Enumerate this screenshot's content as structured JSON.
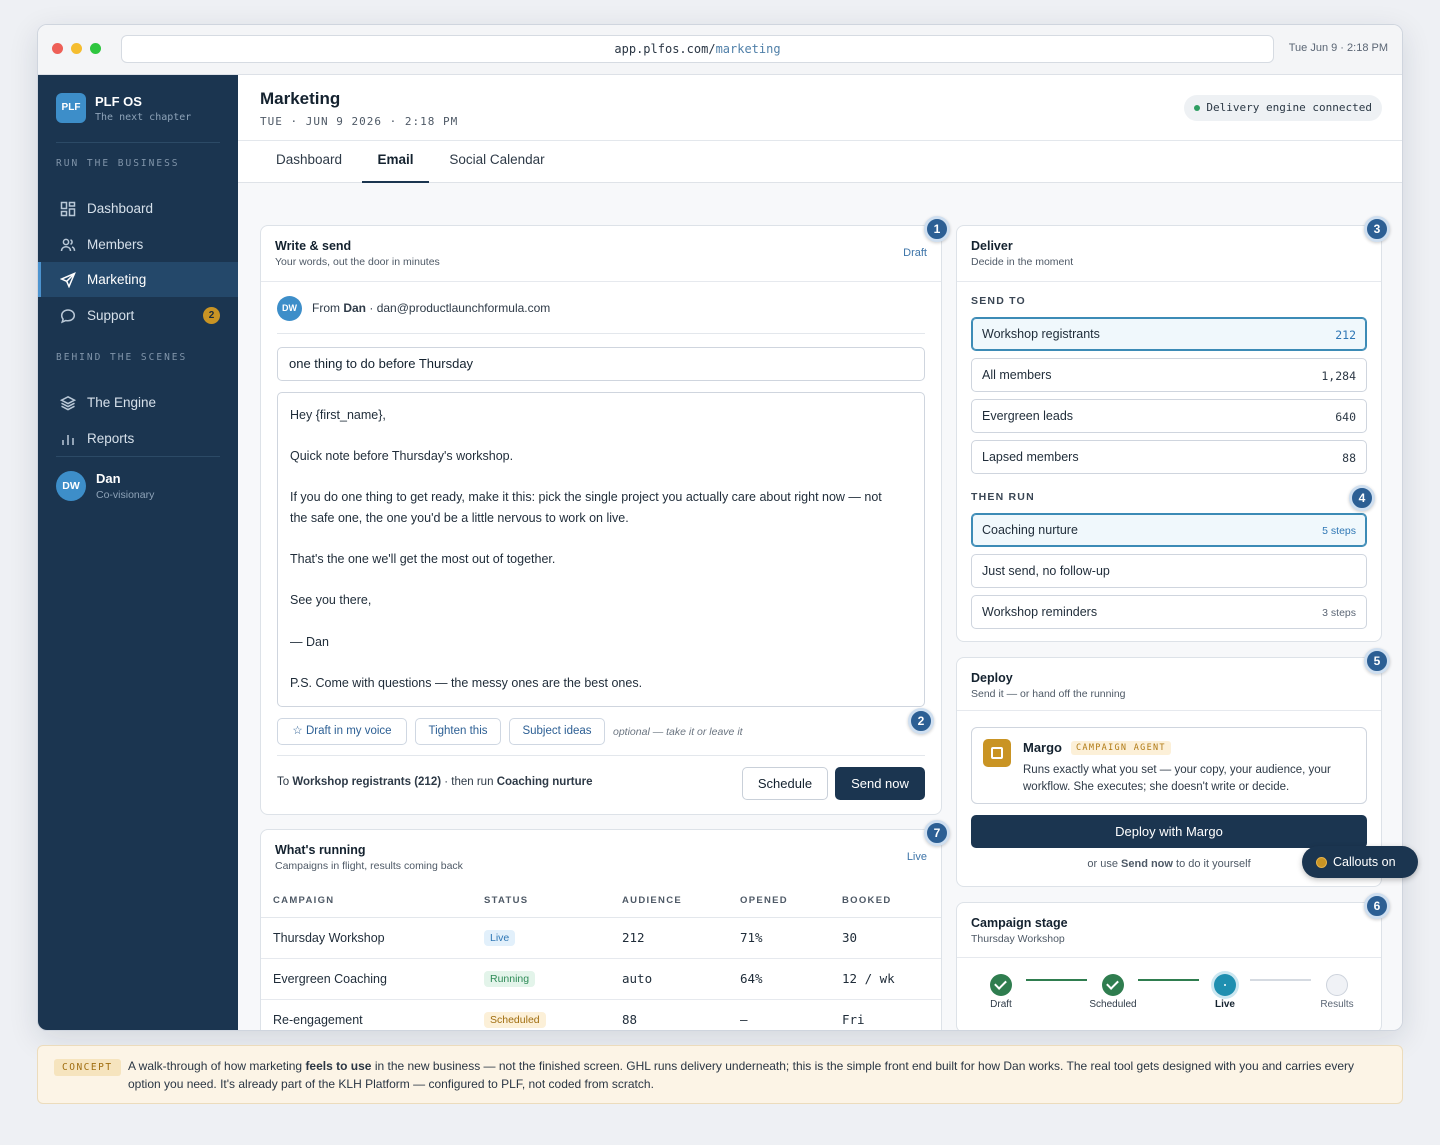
{
  "window": {
    "url_host": "app.plfos.com/",
    "url_path": "marketing",
    "clock": "Tue Jun 9 · 2:18 PM"
  },
  "sidebar": {
    "brand_badge": "PLF",
    "brand_name": "PLF OS",
    "brand_tagline": "The next chapter",
    "section_run": "RUN THE BUSINESS",
    "section_behind": "BEHIND THE SCENES",
    "items": [
      {
        "label": "Dashboard",
        "icon": "grid-icon"
      },
      {
        "label": "Members",
        "icon": "users-icon"
      },
      {
        "label": "Marketing",
        "icon": "send-icon",
        "active": true
      },
      {
        "label": "Support",
        "icon": "chat-icon",
        "badge": "2"
      },
      {
        "label": "The Engine",
        "icon": "layers-icon"
      },
      {
        "label": "Reports",
        "icon": "bar-chart-icon"
      }
    ],
    "user": {
      "initials": "DW",
      "name": "Dan",
      "role": "Co-visionary"
    }
  },
  "header": {
    "title": "Marketing",
    "date": "TUE · JUN 9 2026 · 2:18 PM",
    "status": "Delivery engine connected"
  },
  "tabs": [
    {
      "label": "Dashboard"
    },
    {
      "label": "Email",
      "active": true
    },
    {
      "label": "Social Calendar"
    }
  ],
  "write": {
    "title": "Write & send",
    "subtitle": "Your words, out the door in minutes",
    "tag": "Draft",
    "callout": "1",
    "from_initials": "DW",
    "from_prefix": "From",
    "from_name": "Dan",
    "from_email": "· dan@productlaunchformula.com",
    "subject": "one thing to do before Thursday",
    "body": {
      "l1": "Hey {first_name},",
      "l2": "Quick note before Thursday's workshop.",
      "l3": "If you do one thing to get ready, make it this: pick the single project you actually care about right now — not",
      "l4": "the safe one, the one you'd be a little nervous to work on live.",
      "l5": "That's the one we'll get the most out of together.",
      "l6": "See you there,",
      "l7": "— Dan",
      "l8": "P.S. Come with questions — the messy ones are the best ones."
    },
    "assist": {
      "voice": "Draft in my voice",
      "tighten": "Tighten this",
      "subjects": "Subject ideas",
      "note": "optional — take it or leave it",
      "callout": "2"
    },
    "route": {
      "to": "To",
      "audience": "Workshop registrants (212)",
      "then": "· then run",
      "workflow": "Coaching nurture"
    },
    "schedule_label": "Schedule",
    "send_label": "Send now"
  },
  "running": {
    "title": "What's running",
    "subtitle": "Campaigns in flight, results coming back",
    "tag": "Live",
    "callout": "7",
    "columns": [
      "CAMPAIGN",
      "STATUS",
      "AUDIENCE",
      "OPENED",
      "BOOKED"
    ],
    "rows": [
      {
        "campaign": "Thursday Workshop",
        "status": "Live",
        "kind": "live",
        "audience": "212",
        "opened": "71%",
        "booked": "30"
      },
      {
        "campaign": "Evergreen Coaching",
        "status": "Running",
        "kind": "running",
        "audience": "auto",
        "opened": "64%",
        "booked": "12 / wk"
      },
      {
        "campaign": "Re-engagement",
        "status": "Scheduled",
        "kind": "scheduled",
        "audience": "88",
        "opened": "—",
        "booked": "Fri"
      }
    ]
  },
  "deliver": {
    "title": "Deliver",
    "subtitle": "Decide in the moment",
    "callout": "3",
    "send_to_label": "SEND TO",
    "audiences": [
      {
        "label": "Workshop registrants",
        "count": "212",
        "selected": true
      },
      {
        "label": "All members",
        "count": "1,284"
      },
      {
        "label": "Evergreen leads",
        "count": "640"
      },
      {
        "label": "Lapsed members",
        "count": "88"
      }
    ],
    "then_run_label": "THEN RUN",
    "then_callout": "4",
    "workflows": [
      {
        "label": "Coaching nurture",
        "steps": "5 steps",
        "selected": true
      },
      {
        "label": "Just send, no follow-up",
        "steps": ""
      },
      {
        "label": "Workshop reminders",
        "steps": "3 steps"
      }
    ]
  },
  "deploy": {
    "title": "Deploy",
    "subtitle": "Send it — or hand off the running",
    "callout": "5",
    "agent_name": "Margo",
    "agent_tag": "CAMPAIGN AGENT",
    "agent_desc": "Runs exactly what you set — your copy, your audience, your workflow. She executes; she doesn't write or decide.",
    "button": "Deploy with Margo",
    "note_prefix": "or use",
    "note_strong": "Send now",
    "note_suffix": "to do it yourself"
  },
  "stage": {
    "title": "Campaign stage",
    "subtitle": "Thursday Workshop",
    "callout": "6",
    "steps": [
      {
        "label": "Draft",
        "state": "done"
      },
      {
        "label": "Scheduled",
        "state": "done"
      },
      {
        "label": "Live",
        "state": "current"
      },
      {
        "label": "Results",
        "state": "todo"
      }
    ]
  },
  "callouts_toggle": "Callouts on",
  "concept": {
    "tag": "CONCEPT",
    "t1": "A walk-through of how marketing",
    "t_strong": "feels to use",
    "t2": "in the new business — not the finished screen. GHL runs delivery underneath; this is the simple front end built for how Dan works. The real tool gets designed with you and carries every option you need. It's already part of the KLH Platform — configured to PLF, not coded from scratch."
  },
  "colors": {
    "navy": "#1b3550",
    "accent": "#3d8ec9",
    "gold": "#c99424",
    "green": "#2f7d4f",
    "teal": "#1f8fb0"
  }
}
